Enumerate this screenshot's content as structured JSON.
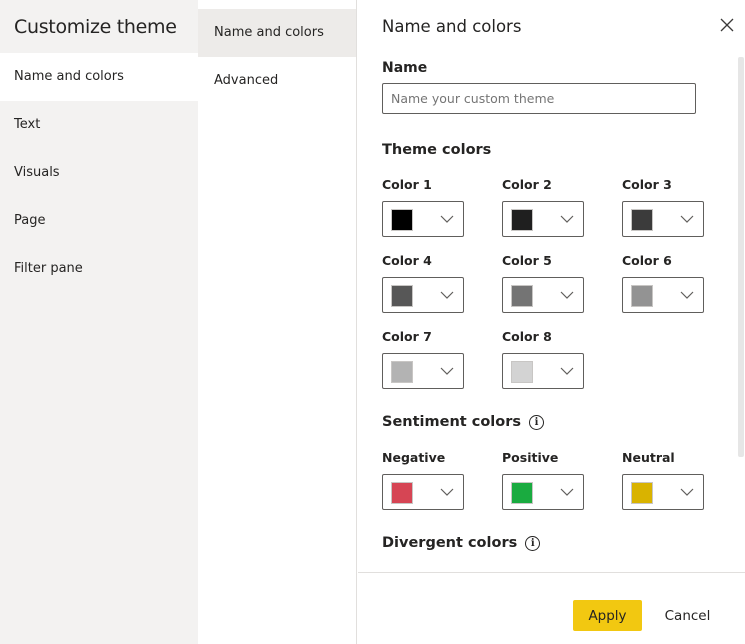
{
  "sidebar": {
    "title": "Customize theme",
    "items": [
      {
        "label": "Name and colors"
      },
      {
        "label": "Text"
      },
      {
        "label": "Visuals"
      },
      {
        "label": "Page"
      },
      {
        "label": "Filter pane"
      }
    ]
  },
  "subnav": {
    "items": [
      {
        "label": "Name and colors"
      },
      {
        "label": "Advanced"
      }
    ]
  },
  "panel": {
    "title": "Name and colors",
    "name_label": "Name",
    "name_placeholder": "Name your custom theme",
    "theme_colors_title": "Theme colors",
    "theme_colors": [
      {
        "label": "Color 1",
        "color": "#000000"
      },
      {
        "label": "Color 2",
        "color": "#1f1f1f"
      },
      {
        "label": "Color 3",
        "color": "#3b3b3b"
      },
      {
        "label": "Color 4",
        "color": "#575757"
      },
      {
        "label": "Color 5",
        "color": "#747474"
      },
      {
        "label": "Color 6",
        "color": "#939393"
      },
      {
        "label": "Color 7",
        "color": "#b3b3b3"
      },
      {
        "label": "Color 8",
        "color": "#d3d3d3"
      }
    ],
    "sentiment_title": "Sentiment colors",
    "sentiment_colors": [
      {
        "label": "Negative",
        "color": "#d64554"
      },
      {
        "label": "Positive",
        "color": "#1aab40"
      },
      {
        "label": "Neutral",
        "color": "#d9b300"
      }
    ],
    "divergent_title": "Divergent colors"
  },
  "footer": {
    "apply": "Apply",
    "cancel": "Cancel"
  }
}
